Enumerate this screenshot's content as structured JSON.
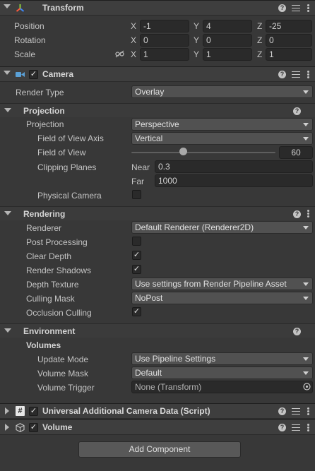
{
  "transform": {
    "title": "Transform",
    "position": {
      "label": "Position",
      "x": "-1",
      "y": "4",
      "z": "-25"
    },
    "rotation": {
      "label": "Rotation",
      "x": "0",
      "y": "0",
      "z": "0"
    },
    "scale": {
      "label": "Scale",
      "x": "1",
      "y": "1",
      "z": "1"
    },
    "axis_x": "X",
    "axis_y": "Y",
    "axis_z": "Z"
  },
  "camera": {
    "title": "Camera",
    "render_type": {
      "label": "Render Type",
      "value": "Overlay"
    },
    "projection": {
      "header": "Projection",
      "projection": {
        "label": "Projection",
        "value": "Perspective"
      },
      "fov_axis": {
        "label": "Field of View Axis",
        "value": "Vertical"
      },
      "fov": {
        "label": "Field of View",
        "value": "60",
        "slider_fraction": 0.36
      },
      "clipping": {
        "label": "Clipping Planes",
        "near_label": "Near",
        "near": "0.3",
        "far_label": "Far",
        "far": "1000"
      },
      "physical": {
        "label": "Physical Camera",
        "checked": false
      }
    },
    "rendering": {
      "header": "Rendering",
      "renderer": {
        "label": "Renderer",
        "value": "Default Renderer (Renderer2D)"
      },
      "post_processing": {
        "label": "Post Processing",
        "checked": false
      },
      "clear_depth": {
        "label": "Clear Depth",
        "checked": true
      },
      "render_shadows": {
        "label": "Render Shadows",
        "checked": true
      },
      "depth_texture": {
        "label": "Depth Texture",
        "value": "Use settings from Render Pipeline Asset"
      },
      "culling_mask": {
        "label": "Culling Mask",
        "value": "NoPost"
      },
      "occlusion_culling": {
        "label": "Occlusion Culling",
        "checked": true
      }
    },
    "environment": {
      "header": "Environment",
      "volumes_header": "Volumes",
      "update_mode": {
        "label": "Update Mode",
        "value": "Use Pipeline Settings"
      },
      "volume_mask": {
        "label": "Volume Mask",
        "value": "Default"
      },
      "volume_trigger": {
        "label": "Volume Trigger",
        "value": "None (Transform)"
      }
    }
  },
  "components": {
    "additional_camera_data": "Universal Additional Camera Data (Script)",
    "volume": "Volume"
  },
  "add_component": "Add Component",
  "icons": {
    "help": "?",
    "check": "✓",
    "script": "#"
  }
}
